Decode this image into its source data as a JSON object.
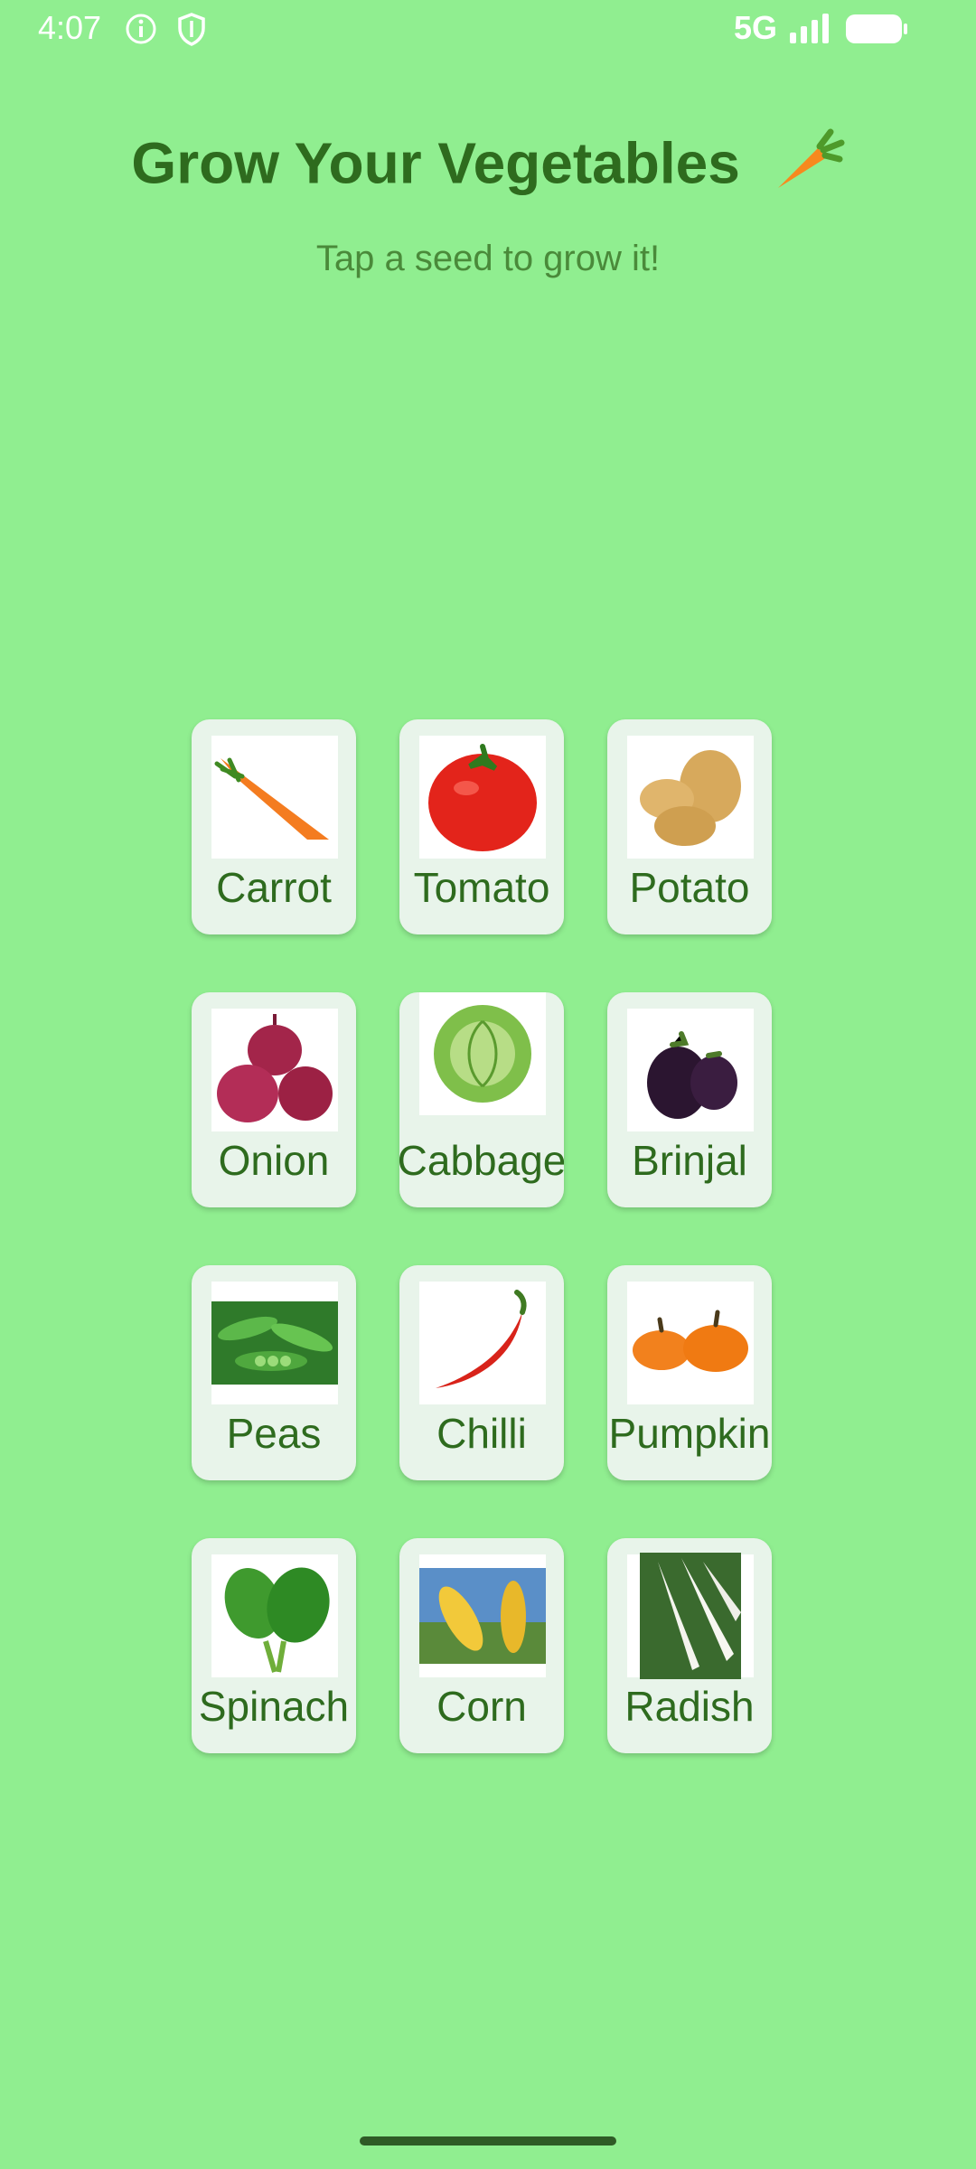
{
  "status_bar": {
    "time": "4:07",
    "network": "5G",
    "icons": [
      "info-icon",
      "shield-icon",
      "signal-icon",
      "battery-icon"
    ]
  },
  "header": {
    "title": "Grow Your Vegetables",
    "title_icon": "carrot-icon",
    "subtitle": "Tap a seed to grow it!"
  },
  "vegetables": [
    {
      "label": "Carrot",
      "icon": "carrot-icon"
    },
    {
      "label": "Tomato",
      "icon": "tomato-icon"
    },
    {
      "label": "Potato",
      "icon": "potato-icon"
    },
    {
      "label": "Onion",
      "icon": "onion-icon"
    },
    {
      "label": "Cabbage",
      "icon": "cabbage-icon"
    },
    {
      "label": "Brinjal",
      "icon": "brinjal-icon"
    },
    {
      "label": "Peas",
      "icon": "peas-icon"
    },
    {
      "label": "Chilli",
      "icon": "chilli-icon"
    },
    {
      "label": "Pumpkin",
      "icon": "pumpkin-icon"
    },
    {
      "label": "Spinach",
      "icon": "spinach-icon"
    },
    {
      "label": "Corn",
      "icon": "corn-icon"
    },
    {
      "label": "Radish",
      "icon": "radish-icon"
    }
  ],
  "colors": {
    "background": "#90ee90",
    "title": "#2e6b1e",
    "card": "#e8f4ea"
  }
}
